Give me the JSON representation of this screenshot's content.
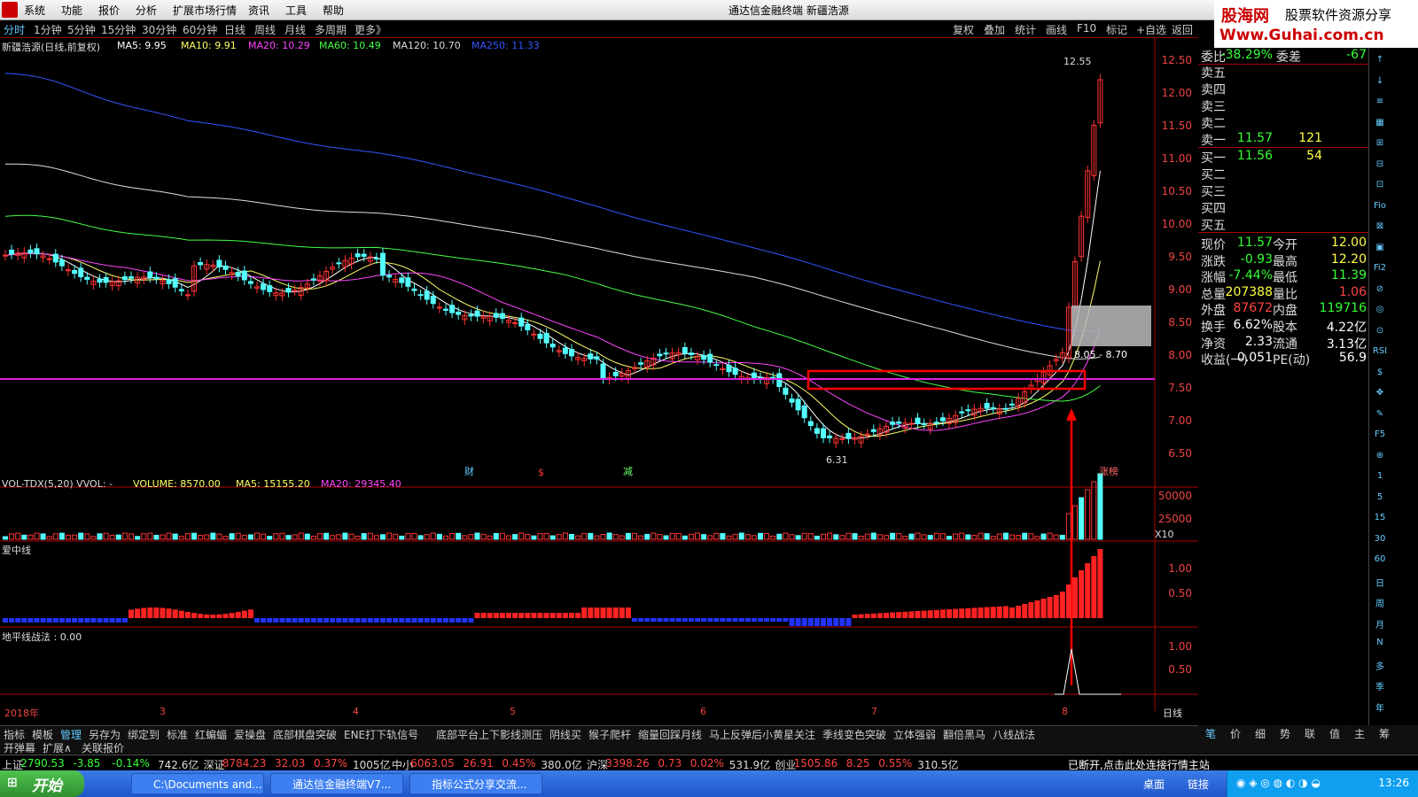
{
  "menubar": {
    "items": [
      "系统",
      "功能",
      "报价",
      "分析",
      "扩展市场行情",
      "资讯",
      "工具",
      "帮助"
    ],
    "title": "通达信金融终端  新疆浩源",
    "guhai_site": "股海网",
    "guhai_tag": "股票软件资源分享",
    "guhai_url": "Www.Guhai.com.cn"
  },
  "toolbar": {
    "periods": [
      "分时",
      "1分钟",
      "5分钟",
      "15分钟",
      "30分钟",
      "60分钟",
      "日线",
      "周线",
      "月线",
      "多周期",
      "更多》"
    ],
    "right": [
      "复权",
      "叠加",
      "统计",
      "画线",
      "F10",
      "标记",
      "+自选",
      "返回"
    ]
  },
  "main_panel": {
    "title": "新疆浩源(日线,前复权)",
    "ma": [
      {
        "label": "MA5: 9.95",
        "color": "#ffffff"
      },
      {
        "label": "MA10: 9.91",
        "color": "#ffff66"
      },
      {
        "label": "MA20: 10.29",
        "color": "#ff44ff"
      },
      {
        "label": "MA60: 10.49",
        "color": "#44ff44"
      },
      {
        "label": "MA120: 10.70",
        "color": "#dddddd"
      },
      {
        "label": "MA250: 11.33",
        "color": "#3355ff"
      }
    ],
    "price_axis": [
      "12.50",
      "12.00",
      "11.50",
      "11.00",
      "10.50",
      "10.00",
      "9.50",
      "9.00",
      "8.50",
      "8.00",
      "7.50",
      "7.00",
      "6.50"
    ],
    "high_marker": "12.55",
    "low_marker": "6.31",
    "range_label": "8.05 - 8.70",
    "event_marks": [
      {
        "text": "财",
        "color": "#6cf"
      },
      {
        "text": "$",
        "color": "#f33"
      },
      {
        "text": "减",
        "color": "#6f6"
      },
      {
        "text": "涨榜",
        "color": "#f66"
      }
    ]
  },
  "vol_panel": {
    "title": "VOL-TDX(5,20)  VVOL: -",
    "volume": "VOLUME: 8570.00",
    "ma5": "MA5: 15155.20",
    "ma20": "MA20: 29345.40",
    "axis": [
      "50000",
      "25000"
    ],
    "unit": "X10"
  },
  "ai_panel": {
    "title": "爱中线",
    "axis": [
      "1.00",
      "0.50"
    ]
  },
  "dp_panel": {
    "title": "地平线战法 : 0.00",
    "axis": [
      "1.00",
      "0.50"
    ]
  },
  "date_axis": {
    "labels": [
      "2018年",
      "3",
      "4",
      "5",
      "6",
      "7",
      "8"
    ],
    "mode": "日线"
  },
  "quote": {
    "wei": {
      "label": "委比",
      "value": "-38.29%",
      "label2": "委差",
      "value2": "-67"
    },
    "sell": [
      {
        "label": "卖五",
        "price": "",
        "vol": ""
      },
      {
        "label": "卖四",
        "price": "",
        "vol": ""
      },
      {
        "label": "卖三",
        "price": "",
        "vol": ""
      },
      {
        "label": "卖二",
        "price": "",
        "vol": ""
      },
      {
        "label": "卖一",
        "price": "11.57",
        "vol": "121"
      }
    ],
    "buy": [
      {
        "label": "买一",
        "price": "11.56",
        "vol": "54"
      },
      {
        "label": "买二",
        "price": "",
        "vol": ""
      },
      {
        "label": "买三",
        "price": "",
        "vol": ""
      },
      {
        "label": "买四",
        "price": "",
        "vol": ""
      },
      {
        "label": "买五",
        "price": "",
        "vol": ""
      }
    ],
    "stats": [
      {
        "l1": "现价",
        "v1": "11.57",
        "c1": "#3f3",
        "l2": "今开",
        "v2": "12.00",
        "c2": "#ffff44"
      },
      {
        "l1": "涨跌",
        "v1": "-0.93",
        "c1": "#3f3",
        "l2": "最高",
        "v2": "12.20",
        "c2": "#ffff44"
      },
      {
        "l1": "涨幅",
        "v1": "-7.44%",
        "c1": "#3f3",
        "l2": "最低",
        "v2": "11.39",
        "c2": "#3f3"
      },
      {
        "l1": "总量",
        "v1": "207388",
        "c1": "#ffff44",
        "l2": "量比",
        "v2": "1.06",
        "c2": "#ff4444"
      },
      {
        "l1": "外盘",
        "v1": "87672",
        "c1": "#ff4444",
        "l2": "内盘",
        "v2": "119716",
        "c2": "#3f3"
      },
      {
        "l1": "换手",
        "v1": "6.62%",
        "c1": "#ffffff",
        "l2": "股本",
        "v2": "4.22亿",
        "c2": "#ffffff"
      },
      {
        "l1": "净资",
        "v1": "2.33",
        "c1": "#ffffff",
        "l2": "流通",
        "v2": "3.13亿",
        "c2": "#ffffff"
      },
      {
        "l1": "收益(一)",
        "v1": "0.051",
        "c1": "#ffffff",
        "l2": "PE(动)",
        "v2": "56.9",
        "c2": "#ffffff"
      }
    ]
  },
  "side_icons": [
    "↑",
    "↓",
    "≡",
    "▦",
    "⊞",
    "⊟",
    "⊡",
    "Fio",
    "⊠",
    "▣",
    "Fi2",
    "⊘",
    "◎",
    "⊙",
    "RSI",
    "$",
    "✥",
    "✎",
    "F5",
    "⊕",
    "1",
    "5",
    "15",
    "30",
    "60",
    "日",
    "周",
    "月",
    "N",
    "多",
    "季",
    "年"
  ],
  "bottom_tabs": [
    "指标",
    "模板",
    "管理",
    "另存为",
    "绑定到",
    "标准",
    "红蝙蝠",
    "爱操盘",
    "底部棋盘突破",
    "ENE打下轨信号",
    "底部平台上下影线测压",
    "阴线买",
    "猴子爬杆",
    "缩量回踩月线",
    "马上反弹后小黄星关注",
    "季线变色突破",
    "立体强弱",
    "翻倍黑马",
    "八线战法"
  ],
  "bottom_tabs2": [
    "开弹幕",
    "扩展∧",
    "关联报价"
  ],
  "right_tabs": [
    "笔",
    "价",
    "细",
    "势",
    "联",
    "值",
    "主",
    "筹"
  ],
  "status": {
    "items": [
      {
        "text": "上证",
        "color": "#ddd"
      },
      {
        "text": "2790.53",
        "color": "#3f3"
      },
      {
        "text": "-3.85",
        "color": "#3f3"
      },
      {
        "text": "-0.14%",
        "color": "#3f3"
      },
      {
        "text": "742.6亿",
        "color": "#ddd"
      },
      {
        "text": "深证",
        "color": "#ddd"
      },
      {
        "text": "8784.23",
        "color": "#f44"
      },
      {
        "text": "32.03",
        "color": "#f44"
      },
      {
        "text": "0.37%",
        "color": "#f44"
      },
      {
        "text": "1005亿",
        "color": "#ddd"
      },
      {
        "text": "中小",
        "color": "#ddd"
      },
      {
        "text": "6063.05",
        "color": "#f44"
      },
      {
        "text": "26.91",
        "color": "#f44"
      },
      {
        "text": "0.45%",
        "color": "#f44"
      },
      {
        "text": "380.0亿",
        "color": "#ddd"
      },
      {
        "text": "沪深",
        "color": "#ddd"
      },
      {
        "text": "3398.26",
        "color": "#f44"
      },
      {
        "text": "0.73",
        "color": "#f44"
      },
      {
        "text": "0.02%",
        "color": "#f44"
      },
      {
        "text": "531.9亿",
        "color": "#ddd"
      },
      {
        "text": "创业",
        "color": "#ddd"
      },
      {
        "text": "1505.86",
        "color": "#f44"
      },
      {
        "text": "8.25",
        "color": "#f44"
      },
      {
        "text": "0.55%",
        "color": "#f44"
      },
      {
        "text": "310.5亿",
        "color": "#ddd"
      }
    ],
    "message": "已断开,点击此处连接行情主站"
  },
  "taskbar": {
    "start": "开始",
    "tasks": [
      "C:\\Documents and...",
      "通达信金融终端V7...",
      "指标公式分享交流..."
    ],
    "desktop": "桌面",
    "links": "链接",
    "clock": "13:26"
  }
}
